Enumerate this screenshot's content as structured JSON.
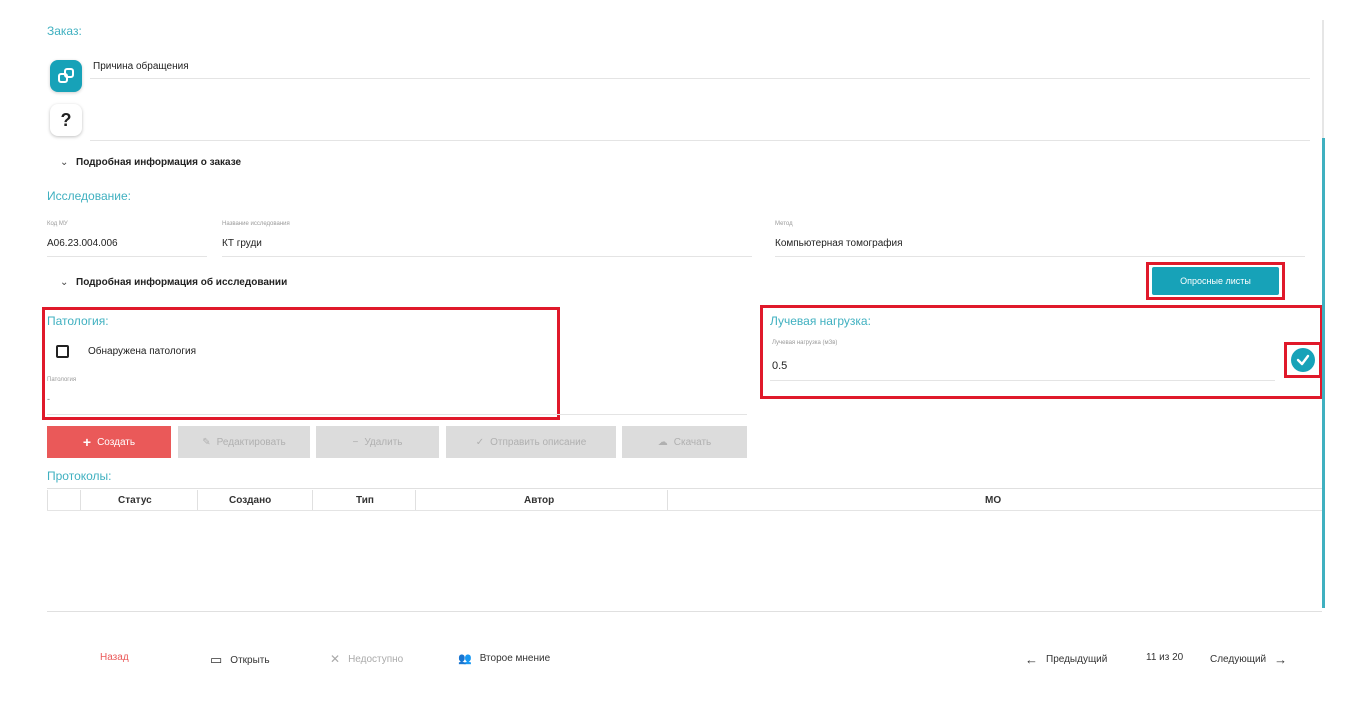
{
  "order": {
    "section_title": "Заказ:",
    "reason_label": "Причина обращения",
    "help_glyph": "?",
    "details_toggle": "Подробная информация о заказе"
  },
  "study": {
    "section_title": "Исследование:",
    "code_label": "Код МУ",
    "code_value": "A06.23.004.006",
    "name_label": "Название исследования",
    "name_value": "КТ груди",
    "method_label": "Метод",
    "method_value": "Компьютерная томография",
    "details_toggle": "Подробная информация об исследовании",
    "questionnaire_button": "Опросные листы"
  },
  "pathology": {
    "section_title": "Патология:",
    "checkbox_label": "Обнаружена патология",
    "note_label": "Патология",
    "note_value": "-"
  },
  "radiation": {
    "section_title": "Лучевая нагрузка:",
    "field_label": "Лучевая нагрузка (мЗв)",
    "value": "0.5"
  },
  "actions": {
    "create": "Создать",
    "edit": "Редактировать",
    "delete": "Удалить",
    "send": "Отправить описание",
    "download": "Скачать"
  },
  "protocols": {
    "section_title": "Протоколы:",
    "columns": [
      "Статус",
      "Создано",
      "Тип",
      "Автор",
      "МО"
    ]
  },
  "footer": {
    "back": "Назад",
    "open": "Открыть",
    "unavailable": "Недоступно",
    "second_opinion": "Второе мнение",
    "prev": "Предыдущий",
    "position": "11 из 20",
    "next": "Следующий"
  },
  "colors": {
    "accent": "#3fb0c0",
    "danger": "#ea5959",
    "highlight": "#e0192a",
    "disabled": "#dcdcdc"
  }
}
